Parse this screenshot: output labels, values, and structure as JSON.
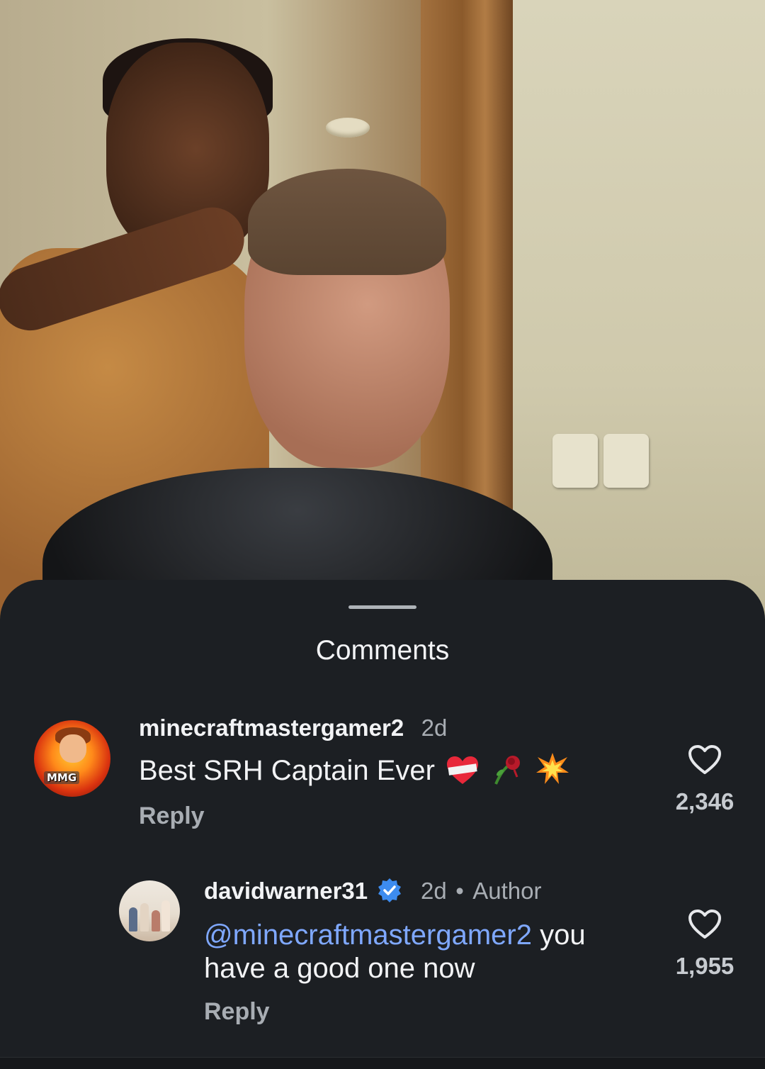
{
  "sheet": {
    "title": "Comments"
  },
  "comments": [
    {
      "username": "minecraftmastergamer2",
      "time": "2d",
      "text": "Best SRH Captain Ever",
      "emoji": [
        "heart-with-bandage",
        "wilted-rose",
        "collision"
      ],
      "reply_label": "Reply",
      "likes": "2,346",
      "avatar_text": "MMG"
    },
    {
      "username": "davidwarner31",
      "verified": true,
      "time": "2d",
      "separator": "•",
      "author_label": "Author",
      "mention": "@minecraftmastergamer2",
      "text_line1": " you",
      "text_line2": "have a good one now",
      "reply_label": "Reply",
      "likes": "1,955"
    }
  ],
  "colors": {
    "background": "#1c1f23",
    "mention": "#7fa8ff",
    "verified": "#3d8cf0"
  }
}
